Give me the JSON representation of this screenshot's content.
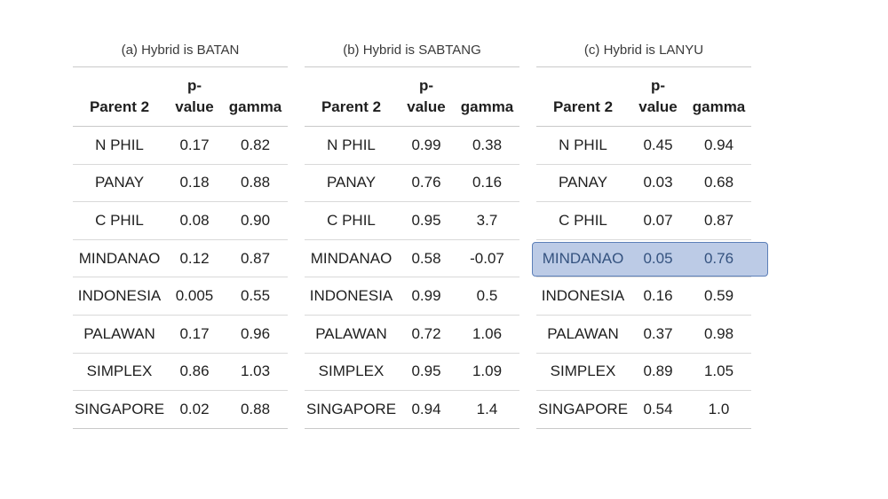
{
  "headers": {
    "parent": "Parent 2",
    "pvalue_line1": "p-",
    "pvalue_line2": "value",
    "gamma": "gamma"
  },
  "tables": [
    {
      "caption": "(a) Hybrid is BATAN",
      "rows": [
        {
          "parent": "N PHIL",
          "p": "0.17",
          "gamma": "0.82"
        },
        {
          "parent": "PANAY",
          "p": "0.18",
          "gamma": "0.88"
        },
        {
          "parent": "C PHIL",
          "p": "0.08",
          "gamma": "0.90"
        },
        {
          "parent": "MINDANAO",
          "p": "0.12",
          "gamma": "0.87"
        },
        {
          "parent": "INDONESIA",
          "p": "0.005",
          "gamma": "0.55"
        },
        {
          "parent": "PALAWAN",
          "p": "0.17",
          "gamma": "0.96"
        },
        {
          "parent": "SIMPLEX",
          "p": "0.86",
          "gamma": "1.03"
        },
        {
          "parent": "SINGAPORE",
          "p": "0.02",
          "gamma": "0.88"
        }
      ]
    },
    {
      "caption": "(b) Hybrid is SABTANG",
      "rows": [
        {
          "parent": "N PHIL",
          "p": "0.99",
          "gamma": "0.38"
        },
        {
          "parent": "PANAY",
          "p": "0.76",
          "gamma": "0.16"
        },
        {
          "parent": "C PHIL",
          "p": "0.95",
          "gamma": "3.7"
        },
        {
          "parent": "MINDANAO",
          "p": "0.58",
          "gamma": "-0.07"
        },
        {
          "parent": "INDONESIA",
          "p": "0.99",
          "gamma": "0.5"
        },
        {
          "parent": "PALAWAN",
          "p": "0.72",
          "gamma": "1.06"
        },
        {
          "parent": "SIMPLEX",
          "p": "0.95",
          "gamma": "1.09"
        },
        {
          "parent": "SINGAPORE",
          "p": "0.94",
          "gamma": "1.4"
        }
      ]
    },
    {
      "caption": "(c) Hybrid is LANYU",
      "rows": [
        {
          "parent": "N PHIL",
          "p": "0.45",
          "gamma": "0.94"
        },
        {
          "parent": "PANAY",
          "p": "0.03",
          "gamma": "0.68"
        },
        {
          "parent": "C PHIL",
          "p": "0.07",
          "gamma": "0.87"
        },
        {
          "parent": "MINDANAO",
          "p": "0.05",
          "gamma": "0.76",
          "highlighted": true
        },
        {
          "parent": "INDONESIA",
          "p": "0.16",
          "gamma": "0.59"
        },
        {
          "parent": "PALAWAN",
          "p": "0.37",
          "gamma": "0.98"
        },
        {
          "parent": "SIMPLEX",
          "p": "0.89",
          "gamma": "1.05"
        },
        {
          "parent": "SINGAPORE",
          "p": "0.54",
          "gamma": "1.0"
        }
      ]
    }
  ]
}
